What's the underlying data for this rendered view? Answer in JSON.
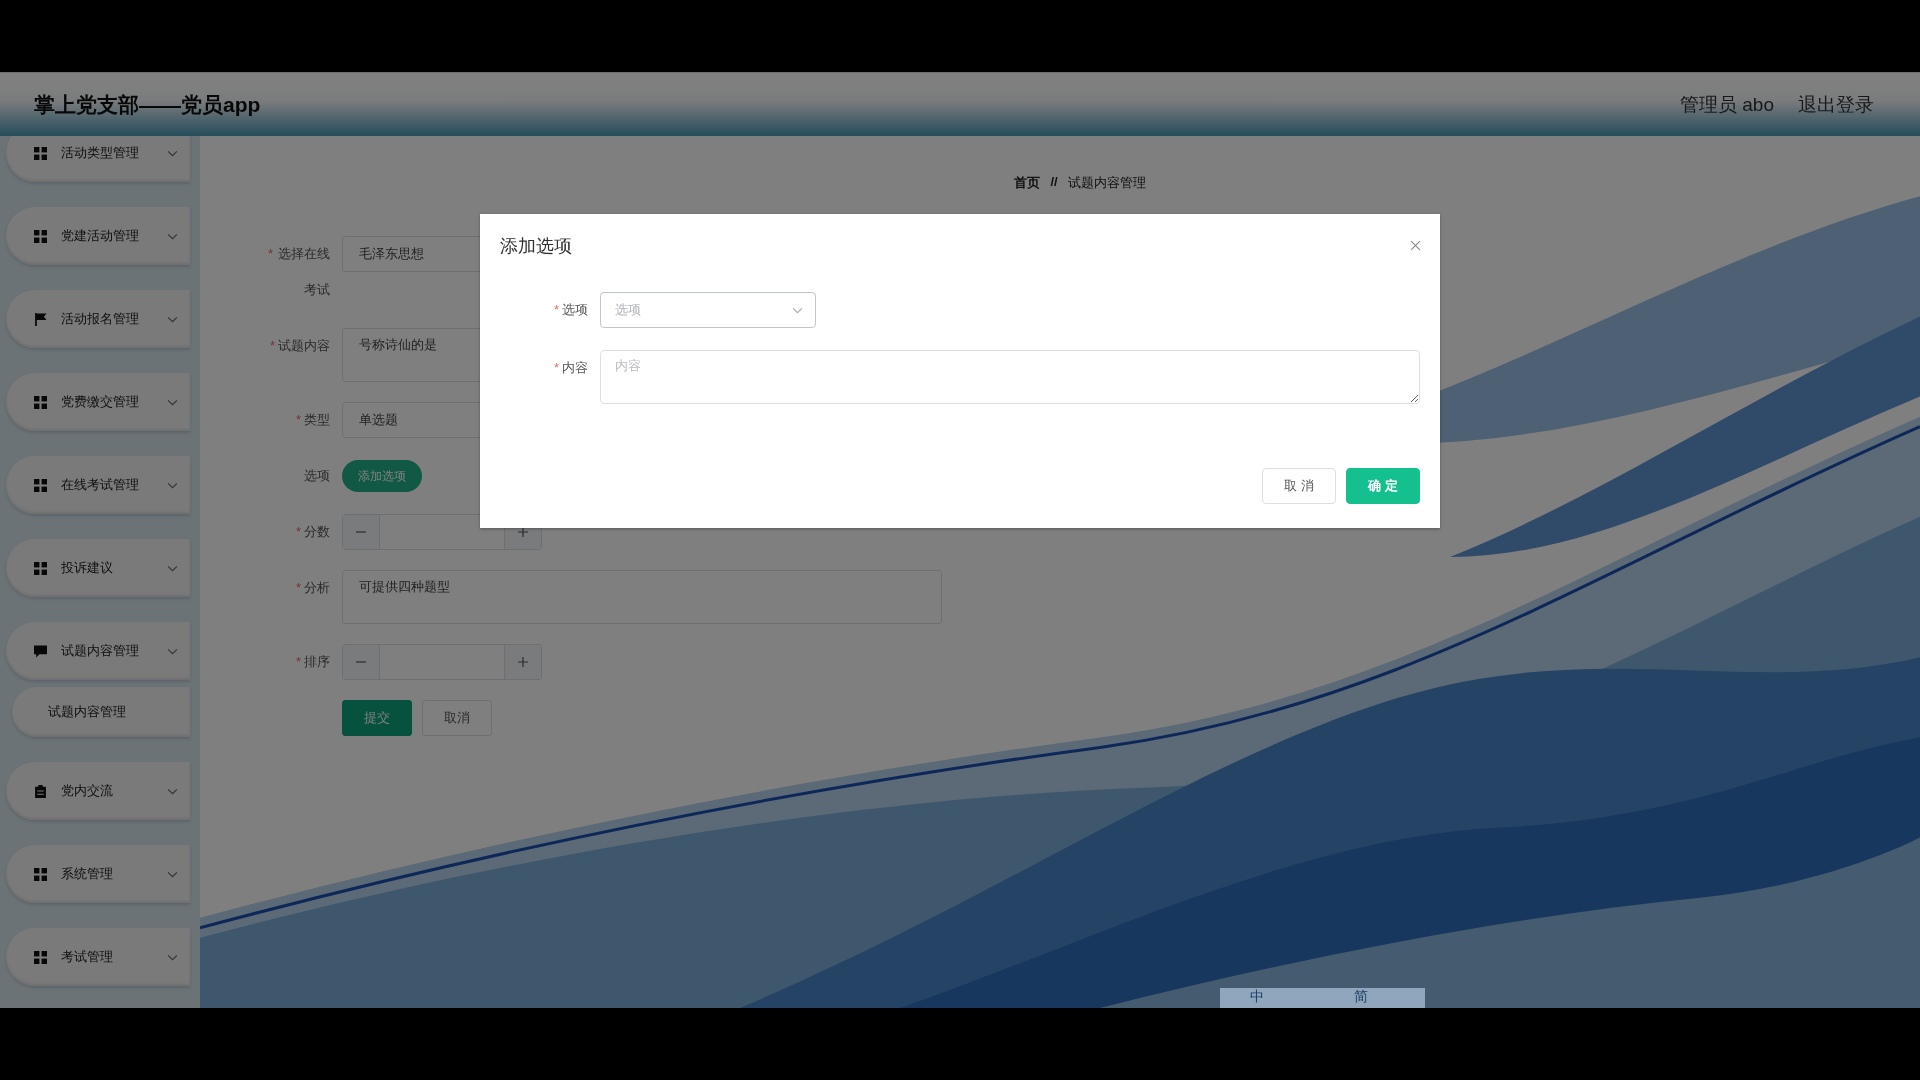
{
  "header": {
    "title": "掌上党支部——党员app",
    "user": "管理员 abo",
    "logout": "退出登录"
  },
  "sidebar": {
    "items": [
      {
        "kind": "grid",
        "label": "活动类型管理"
      },
      {
        "kind": "grid",
        "label": "党建活动管理"
      },
      {
        "kind": "flag",
        "label": "活动报名管理"
      },
      {
        "kind": "grid",
        "label": "党费缴交管理"
      },
      {
        "kind": "grid",
        "label": "在线考试管理"
      },
      {
        "kind": "grid",
        "label": "投诉建议"
      },
      {
        "kind": "comment",
        "label": "试题内容管理",
        "children": [
          {
            "label": "试题内容管理"
          }
        ]
      },
      {
        "kind": "clipboard",
        "label": "党内交流"
      },
      {
        "kind": "grid",
        "label": "系统管理"
      },
      {
        "kind": "grid",
        "label": "考试管理"
      }
    ]
  },
  "breadcrumb": {
    "home": "首页",
    "separator": "//",
    "current": "试题内容管理"
  },
  "form": {
    "fields": [
      {
        "kind": "text",
        "required_mark": "*",
        "label": "选择在线考试",
        "value": "毛泽东思想"
      },
      {
        "kind": "textarea",
        "required_mark": "*",
        "label": "试题内容",
        "value": "号称诗仙的是"
      },
      {
        "kind": "text",
        "required_mark": "*",
        "label": "类型",
        "value": "单选题"
      },
      {
        "kind": "button",
        "label": "选项",
        "button": "添加选项"
      },
      {
        "kind": "number",
        "required_mark": "*",
        "label": "分数"
      },
      {
        "kind": "textarea",
        "required_mark": "*",
        "label": "分析",
        "value": "可提供四种题型"
      },
      {
        "kind": "number",
        "required_mark": "*",
        "label": "排序"
      }
    ],
    "buttons": [
      {
        "label": "提交",
        "primary": true
      },
      {
        "label": "取消",
        "primary": false
      }
    ]
  },
  "dialog": {
    "title": "添加选项",
    "fields": [
      {
        "kind": "select",
        "required_mark": "*",
        "label": "选项",
        "placeholder": "选项"
      },
      {
        "kind": "textarea",
        "required_mark": "*",
        "label": "内容",
        "placeholder": "内容"
      }
    ],
    "buttons": [
      {
        "label": "取 消",
        "primary": false
      },
      {
        "label": "确 定",
        "primary": true
      }
    ]
  },
  "ime_toolbar": {
    "input_mode": "中",
    "script": "简"
  }
}
